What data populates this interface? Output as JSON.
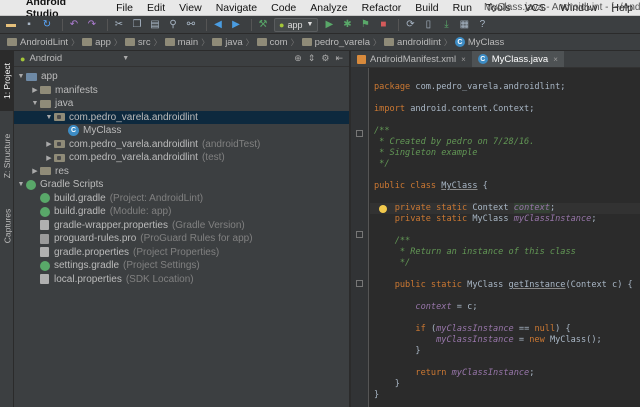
{
  "menubar": {
    "app_name": "Android Studio",
    "items": [
      "File",
      "Edit",
      "View",
      "Navigate",
      "Code",
      "Analyze",
      "Refactor",
      "Build",
      "Run",
      "Tools",
      "VCS",
      "Window",
      "Help"
    ],
    "window_title": "MyClass.java - AndroidLint - [~/Android"
  },
  "toolbar": {
    "run_config": "app"
  },
  "breadcrumbs": [
    "AndroidLint",
    "app",
    "src",
    "main",
    "java",
    "com",
    "pedro_varela",
    "androidlint",
    "MyClass"
  ],
  "toolstrip": {
    "tabs": [
      "1: Project",
      "Z: Structure",
      "Captures"
    ]
  },
  "project": {
    "view_mode": "Android",
    "tree": [
      {
        "label": "app",
        "sub": ""
      },
      {
        "label": "manifests",
        "sub": ""
      },
      {
        "label": "java",
        "sub": ""
      },
      {
        "label": "com.pedro_varela.androidlint",
        "sub": ""
      },
      {
        "label": "MyClass",
        "sub": ""
      },
      {
        "label": "com.pedro_varela.androidlint",
        "sub": "(androidTest)"
      },
      {
        "label": "com.pedro_varela.androidlint",
        "sub": "(test)"
      },
      {
        "label": "res",
        "sub": ""
      },
      {
        "label": "Gradle Scripts",
        "sub": ""
      },
      {
        "label": "build.gradle",
        "sub": "(Project: AndroidLint)"
      },
      {
        "label": "build.gradle",
        "sub": "(Module: app)"
      },
      {
        "label": "gradle-wrapper.properties",
        "sub": "(Gradle Version)"
      },
      {
        "label": "proguard-rules.pro",
        "sub": "(ProGuard Rules for app)"
      },
      {
        "label": "gradle.properties",
        "sub": "(Project Properties)"
      },
      {
        "label": "settings.gradle",
        "sub": "(Project Settings)"
      },
      {
        "label": "local.properties",
        "sub": "(SDK Location)"
      }
    ]
  },
  "editor": {
    "tabs": [
      "AndroidManifest.xml",
      "MyClass.java"
    ],
    "code": {
      "l1_kw": "package",
      "l1_rest": " com.pedro_varela.androidlint;",
      "l2_kw": "import",
      "l2_rest": " android.content.Context;",
      "c1": "/**",
      "c2": " * Created by pedro on 7/28/16.",
      "c3": " * Singleton example",
      "c4": " */",
      "cls_kw": "public class",
      "cls_name": "MyClass",
      "cls_rest": " {",
      "f1_kw": "private static",
      "f1_type": " Context ",
      "f1_name": "context",
      "f1_end": ";",
      "f2_kw": "private static",
      "f2_type": " MyClass ",
      "f2_name": "myClassInstance",
      "f2_end": ";",
      "d1": "/**",
      "d2": " * Return an instance of this class",
      "d3": " */",
      "m_kw": "public static",
      "m_type": " MyClass ",
      "m_name": "getInstance",
      "m_rest": "(Context c) {",
      "a_name": "context",
      "a_rest": " = c;",
      "if_kw": "if",
      "if_open": " (",
      "if_name": "myClassInstance",
      "if_op": " == ",
      "if_null": "null",
      "if_rest": ") {",
      "n_name": "myClassInstance",
      "n_op": " = ",
      "n_kw": "new",
      "n_rest": " MyClass();",
      "close1": "}",
      "r_kw": "return",
      "r_name": " myClassInstance",
      "r_end": ";",
      "close2": "}",
      "close3": "}"
    }
  }
}
